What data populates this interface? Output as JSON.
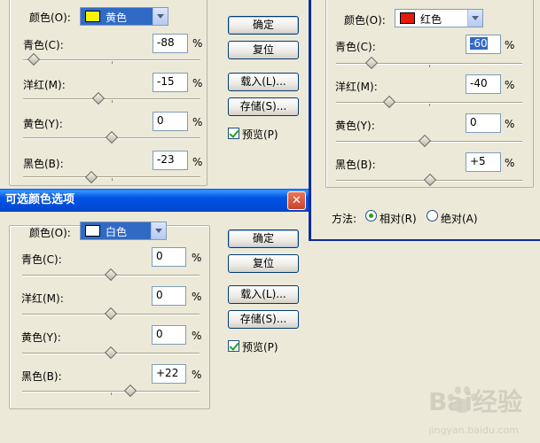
{
  "topleft": {
    "color_label": "颜色(O):",
    "color_value": "黄色",
    "swatch": "#f5f500",
    "sliders": [
      {
        "label": "青色(C):",
        "value": "-88",
        "unit": "%"
      },
      {
        "label": "洋红(M):",
        "value": "-15",
        "unit": "%"
      },
      {
        "label": "黄色(Y):",
        "value": "0",
        "unit": "%"
      },
      {
        "label": "黑色(B):",
        "value": "-23",
        "unit": "%"
      }
    ],
    "buttons": {
      "ok": "确定",
      "reset": "复位",
      "load": "载入(L)...",
      "save": "存储(S)..."
    },
    "preview": "预览(P)"
  },
  "topright": {
    "color_label": "颜色(O):",
    "color_value": "红色",
    "swatch": "#e31b0c",
    "sliders": [
      {
        "label": "青色(C):",
        "value": "-60",
        "unit": "%"
      },
      {
        "label": "洋红(M):",
        "value": "-40",
        "unit": "%"
      },
      {
        "label": "黄色(Y):",
        "value": "0",
        "unit": "%"
      },
      {
        "label": "黑色(B):",
        "value": "+5",
        "unit": "%"
      }
    ],
    "method_label": "方法:",
    "relative": "相对(R)",
    "absolute": "绝对(A)"
  },
  "bottom": {
    "title": "可选颜色选项",
    "color_label": "颜色(O):",
    "color_value": "白色",
    "swatch": "#ffffff",
    "sliders": [
      {
        "label": "青色(C):",
        "value": "0",
        "unit": "%"
      },
      {
        "label": "洋红(M):",
        "value": "0",
        "unit": "%"
      },
      {
        "label": "黄色(Y):",
        "value": "0",
        "unit": "%"
      },
      {
        "label": "黑色(B):",
        "value": "+22",
        "unit": "%"
      }
    ],
    "buttons": {
      "ok": "确定",
      "reset": "复位",
      "load": "载入(L)...",
      "save": "存储(S)..."
    },
    "preview": "预览(P)"
  },
  "watermark": {
    "brand": "Bai经验",
    "url": "jingyan.baidu.com"
  }
}
